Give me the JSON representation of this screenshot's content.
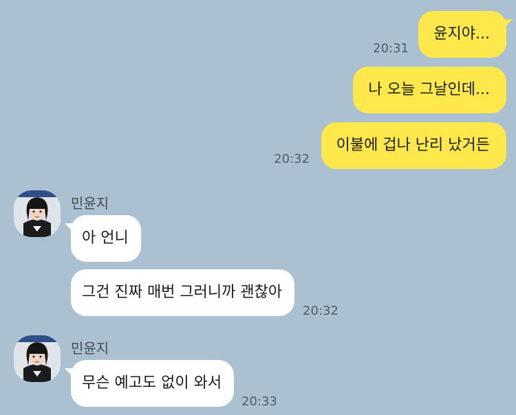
{
  "messages": {
    "m1_text": "윤지야...",
    "m1_time": "20:31",
    "m2_text": "나 오늘 그날인데...",
    "m3_text": "이불에 겁나 난리 났거든",
    "m3_time": "20:32",
    "sender_name": "민윤지",
    "m4_text": "아 언니",
    "m5_text": "그건 진짜 매번 그러니까 괜찮아",
    "m5_time": "20:32",
    "sender_name_2": "민윤지",
    "m6_text": "무슨 예고도 없이 와서",
    "m6_time": "20:33"
  },
  "colors": {
    "background": "#abc1d1",
    "my_bubble": "#fee84c",
    "their_bubble": "#ffffff"
  }
}
